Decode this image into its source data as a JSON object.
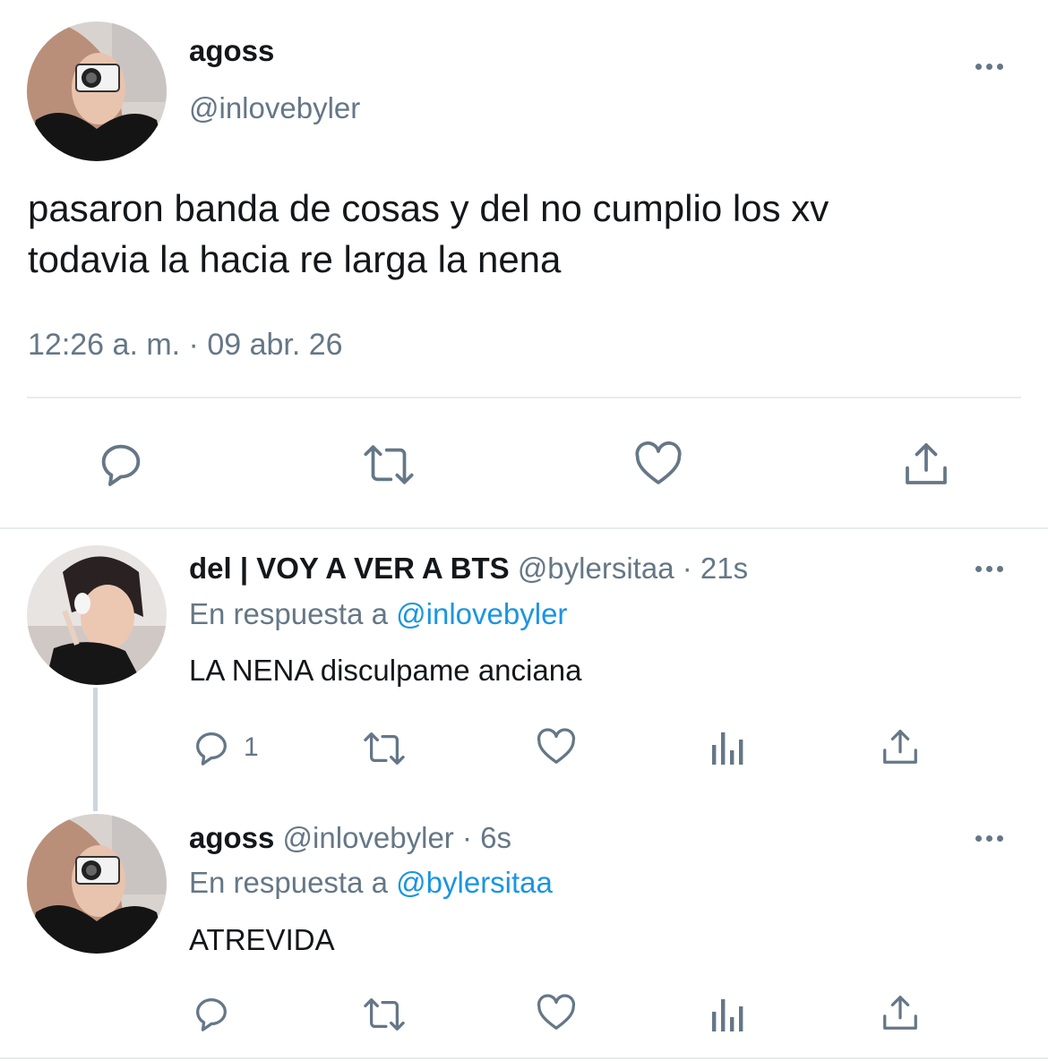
{
  "main_tweet": {
    "display_name": "agoss",
    "handle": "@inlovebyler",
    "text_line1": "pasaron banda de cosas y del no cumplio los xv",
    "text_line2": "todavia la hacia re larga la nena",
    "timestamp": "12:26 a. m. · 09 abr. 26",
    "actions": [
      "reply-icon",
      "retweet-icon",
      "like-icon",
      "share-icon"
    ]
  },
  "replies": [
    {
      "display_name": "del | VOY A VER A BTS",
      "handle": "@bylersitaa",
      "time": "· 21s",
      "reply_prefix": "En respuesta a",
      "reply_to": "@inlovebyler",
      "text": "LA NENA disculpame anciana",
      "reply_count": "1",
      "actions": [
        "reply-icon",
        "retweet-icon",
        "like-icon",
        "analytics-icon",
        "share-icon"
      ]
    },
    {
      "display_name": "agoss",
      "handle": "@inlovebyler",
      "time": "· 6s",
      "reply_prefix": "En respuesta a",
      "reply_to": "@bylersitaa",
      "text": "ATREVIDA",
      "reply_count": "",
      "actions": [
        "reply-icon",
        "retweet-icon",
        "like-icon",
        "analytics-icon",
        "share-icon"
      ]
    }
  ],
  "colors": {
    "text": "#14171a",
    "secondary": "#657786",
    "link": "#1b95e0",
    "divider": "#e6ecf0"
  }
}
